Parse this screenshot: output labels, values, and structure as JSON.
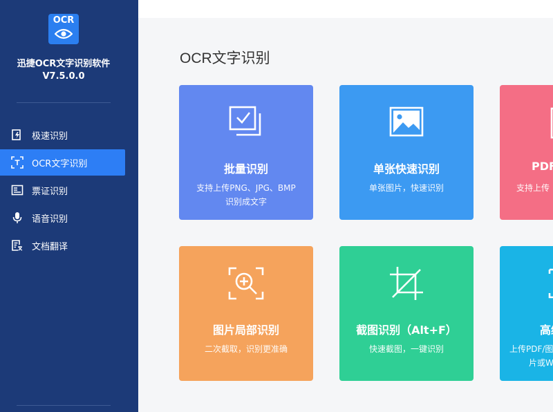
{
  "app": {
    "logo_text": "OCR",
    "name": "迅捷OCR文字识别软件",
    "version": "V7.5.0.0"
  },
  "sidebar": {
    "items": [
      {
        "label": "极速识别",
        "icon": "fast-recognize-icon",
        "active": false
      },
      {
        "label": "OCR文字识别",
        "icon": "text-scan-icon",
        "active": true
      },
      {
        "label": "票证识别",
        "icon": "ticket-icon",
        "active": false
      },
      {
        "label": "语音识别",
        "icon": "microphone-icon",
        "active": false
      },
      {
        "label": "文档翻译",
        "icon": "translate-doc-icon",
        "active": false
      }
    ]
  },
  "main": {
    "title": "OCR文字识别",
    "cards": [
      {
        "title": "批量识别",
        "desc_line1": "支持上传PNG、JPG、BMP",
        "desc_line2": "识别成文字",
        "color": "#6288f0",
        "icon": "batch-images-icon"
      },
      {
        "title": "单张快速识别",
        "desc_line1": "单张图片，快速识别",
        "desc_line2": "",
        "color": "#3c9af2",
        "icon": "image-icon"
      },
      {
        "title": "PDF",
        "desc_line1": "支持上传",
        "desc_line2": "",
        "color": "#f46e85",
        "icon": "pdf-icon"
      },
      {
        "title": "图片局部识别",
        "desc_line1": "二次截取，识别更准确",
        "desc_line2": "",
        "color": "#f5a35c",
        "icon": "zoom-in-icon"
      },
      {
        "title": "截图识别（Alt+F）",
        "desc_line1": "快速截图，一键识别",
        "desc_line2": "",
        "color": "#2fcf95",
        "icon": "crop-icon"
      },
      {
        "title": "高级",
        "desc_line1": "上传PDF/图",
        "desc_line2": "片或W",
        "color": "#1ab4e6",
        "icon": "advanced-icon"
      }
    ]
  }
}
